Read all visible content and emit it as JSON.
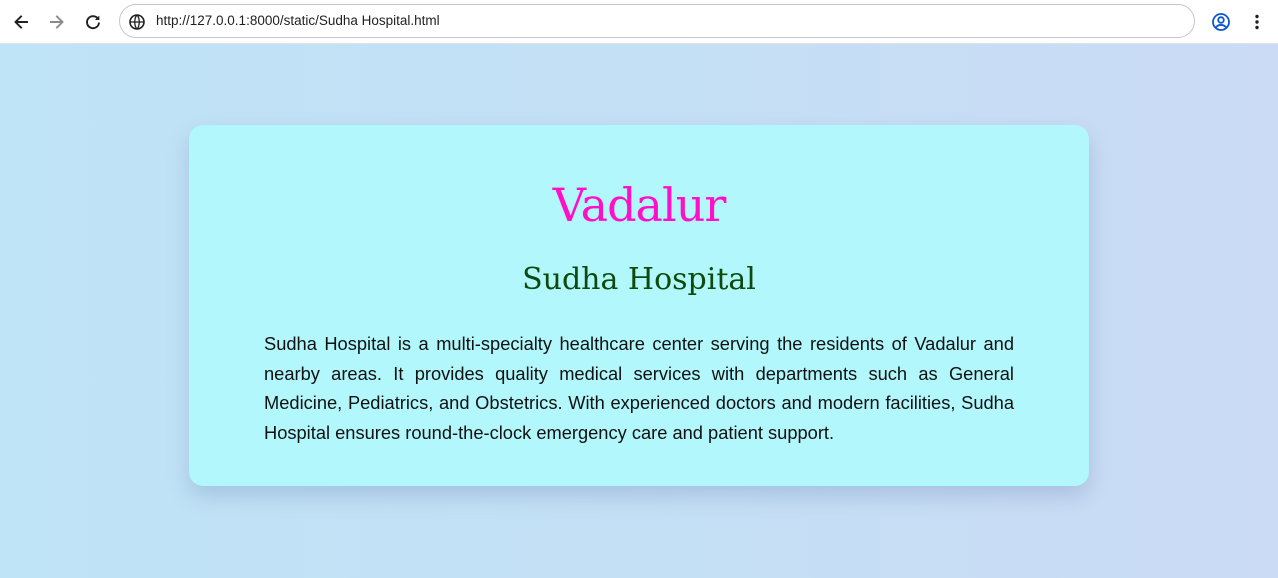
{
  "browser": {
    "url": "http://127.0.0.1:8000/static/Sudha Hospital.html",
    "icons": {
      "back": "arrow-left-icon",
      "forward": "arrow-right-icon",
      "reload": "reload-icon",
      "site_info": "globe-icon",
      "profile": "account-circle-icon",
      "menu": "vertical-dots-icon"
    }
  },
  "page": {
    "title": "Vadalur",
    "subtitle": "Sudha Hospital",
    "description": "Sudha Hospital is a multi-specialty healthcare center serving the residents of Vadalur and nearby areas. It provides quality medical services with departments such as General Medicine, Pediatrics, and Obstetrics. With experienced doctors and modern facilities, Sudha Hospital ensures round-the-clock emergency care and patient support."
  },
  "colors": {
    "title": "#ff10c8",
    "subtitle": "#0e4a0e",
    "card_background": "#b1f7fb",
    "page_background": "#c4e0f5",
    "profile_icon": "#0b57d0"
  }
}
